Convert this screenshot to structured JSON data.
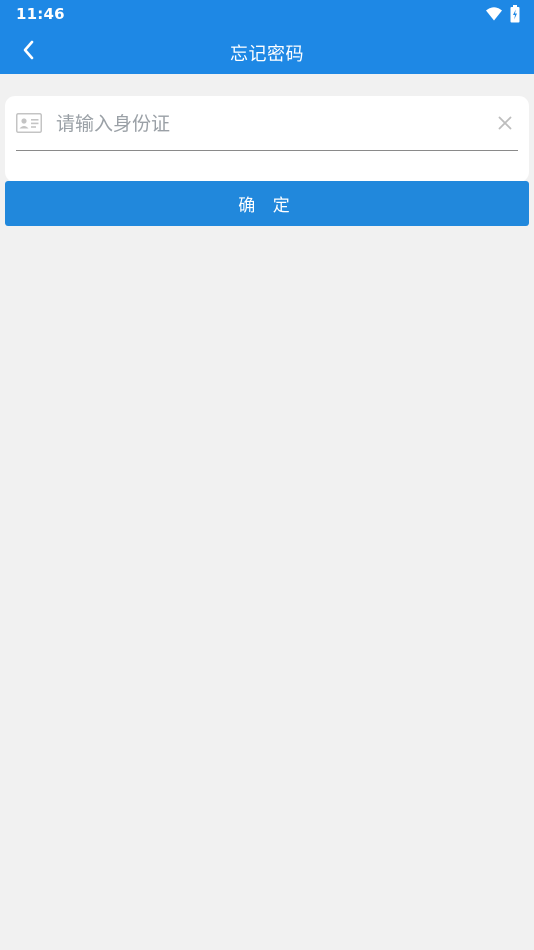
{
  "status_bar": {
    "time": "11:46",
    "icons": [
      "wifi-icon",
      "battery-charging-icon"
    ]
  },
  "header": {
    "title": "忘记密码",
    "back_icon": "chevron-left-icon"
  },
  "form": {
    "id_field": {
      "icon": "id-card-icon",
      "placeholder": "请输入身份证",
      "value": "",
      "clear_icon": "close-icon"
    },
    "confirm_label": "确 定"
  },
  "colors": {
    "primary": "#1e88e5",
    "button": "#2188dc",
    "background": "#f1f1f1",
    "placeholder": "#9aa0a6"
  }
}
